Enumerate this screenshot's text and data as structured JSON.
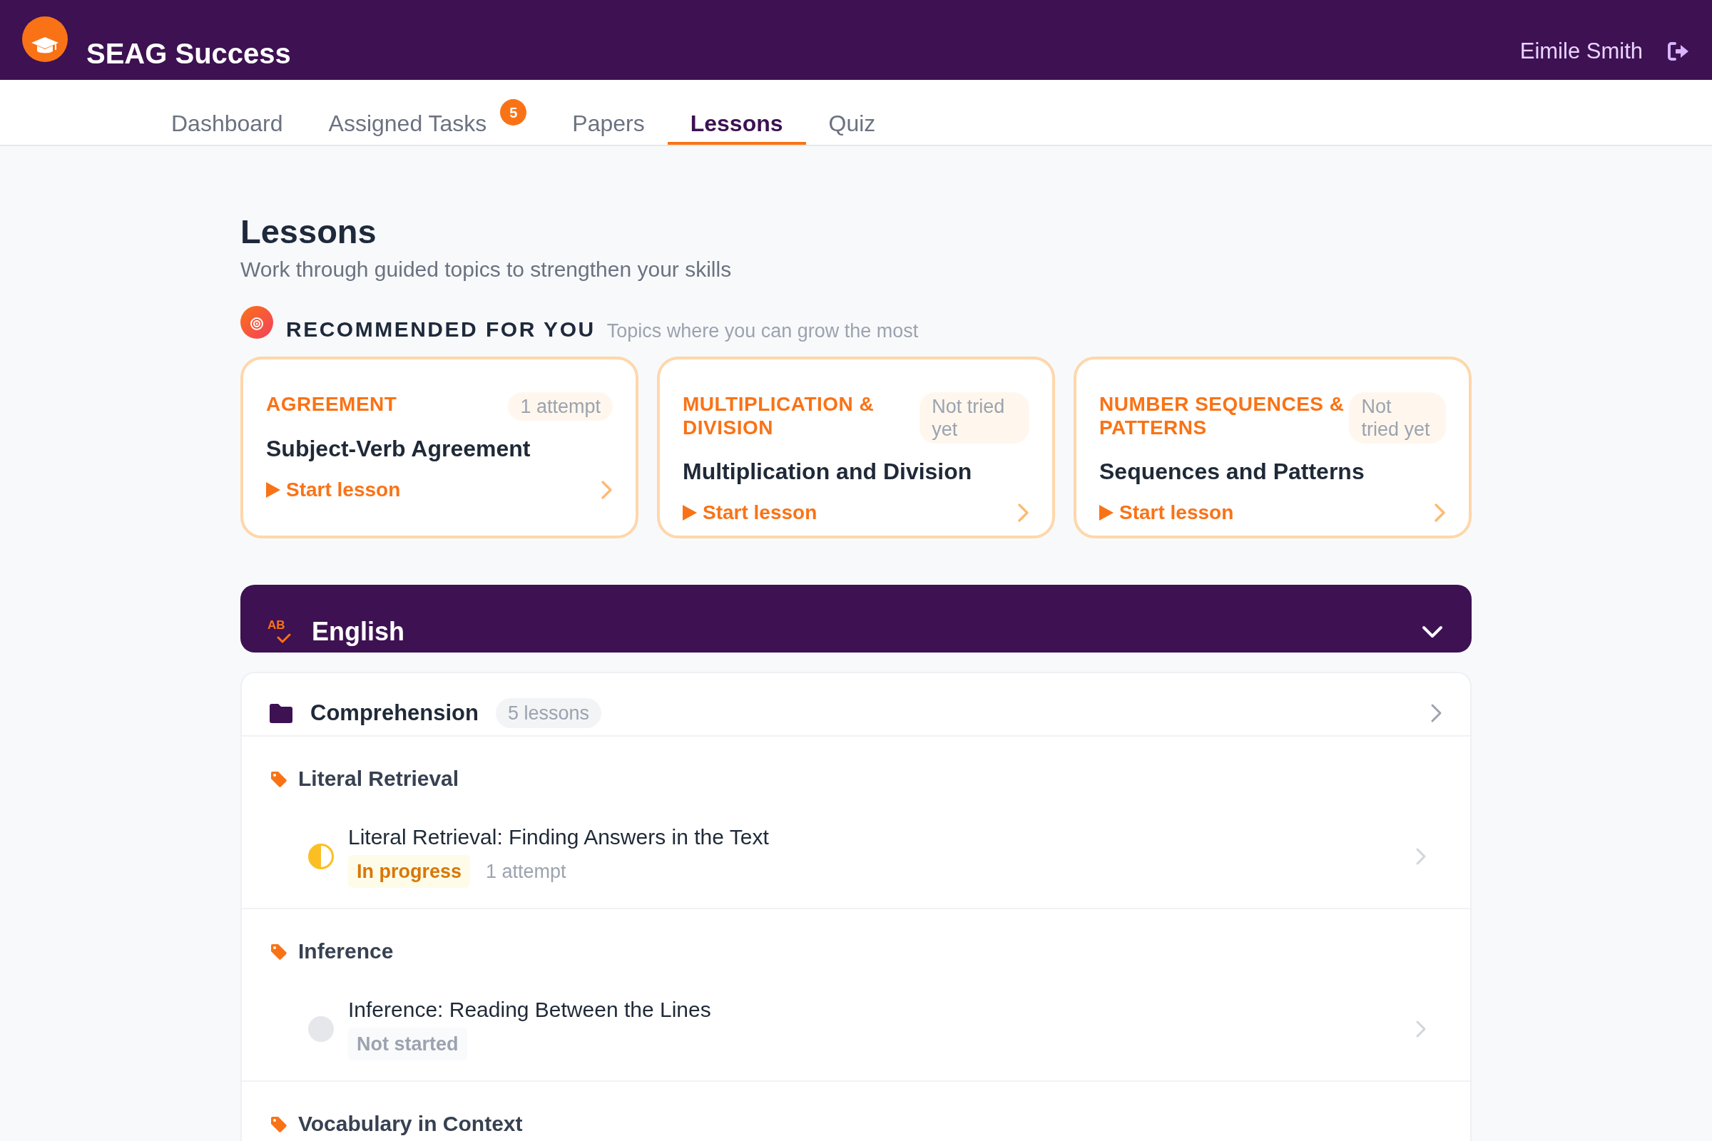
{
  "header": {
    "brand": "SEAG Success",
    "user_name": "Eimile Smith"
  },
  "tabs": [
    {
      "label": "Dashboard",
      "selected": false
    },
    {
      "label": "Assigned Tasks",
      "selected": false,
      "badge": "5"
    },
    {
      "label": "Papers",
      "selected": false
    },
    {
      "label": "Lessons",
      "selected": true
    },
    {
      "label": "Quiz",
      "selected": false
    }
  ],
  "page": {
    "title": "Lessons",
    "subtitle": "Work through guided topics to strengthen your skills"
  },
  "recommended": {
    "heading": "RECOMMENDED FOR YOU",
    "note": "Topics where you can grow the most",
    "cards": [
      {
        "category": "AGREEMENT",
        "status": "1 attempt",
        "title": "Subject-Verb Agreement",
        "action": "Start lesson"
      },
      {
        "category": "MULTIPLICATION & DIVISION",
        "status": "Not tried yet",
        "title": "Multiplication and Division",
        "action": "Start lesson"
      },
      {
        "category": "NUMBER SEQUENCES & PATTERNS",
        "status": "Not tried yet",
        "title": "Sequences and Patterns",
        "action": "Start lesson"
      }
    ]
  },
  "subject": {
    "icon_letters": "AB",
    "name": "English",
    "expanded": true,
    "group": {
      "name": "Comprehension",
      "count": "5 lessons"
    },
    "topics": [
      {
        "name": "Literal Retrieval",
        "lessons": [
          {
            "title": "Literal Retrieval: Finding Answers in the Text",
            "kind": "in_progress",
            "status": "In progress",
            "attempts": "1 attempt"
          }
        ]
      },
      {
        "name": "Inference",
        "lessons": [
          {
            "title": "Inference: Reading Between the Lines",
            "kind": "not_started",
            "status": "Not started"
          }
        ]
      },
      {
        "name": "Vocabulary in Context"
      }
    ]
  }
}
